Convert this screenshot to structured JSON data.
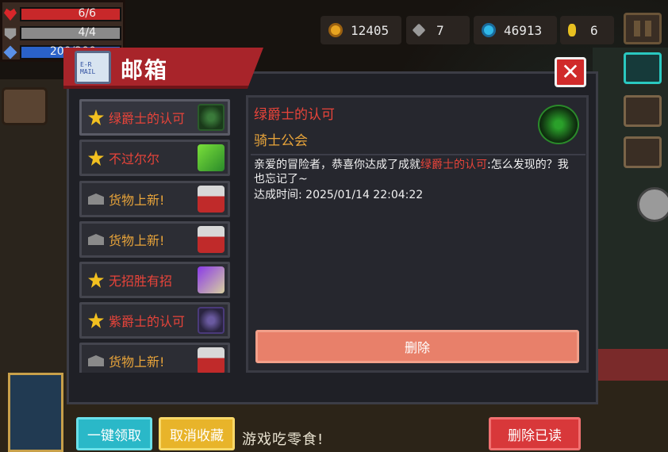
{
  "hud": {
    "hp": "6/6",
    "armor": "4/4",
    "energy": "200/200",
    "coins": "12405",
    "materials": "7",
    "gems": "46913",
    "seeds": "6"
  },
  "background_text": "游戏吃零食!",
  "mailbox": {
    "title": "邮箱",
    "icon_text": "E-R MAIL",
    "items": [
      {
        "label": "绿爵士的认可",
        "type": "star",
        "color": "red",
        "thumb": "green-knight-icon"
      },
      {
        "label": "不过尔尔",
        "type": "star",
        "color": "red",
        "thumb": "leaf-weapon-icon"
      },
      {
        "label": "货物上新!",
        "type": "envelope",
        "color": "gold",
        "thumb": "merchant-icon"
      },
      {
        "label": "货物上新!",
        "type": "envelope",
        "color": "gold",
        "thumb": "merchant-icon"
      },
      {
        "label": "无招胜有招",
        "type": "star",
        "color": "red",
        "thumb": "sword-icon"
      },
      {
        "label": "紫爵士的认可",
        "type": "star",
        "color": "red",
        "thumb": "purple-knight-icon"
      },
      {
        "label": "货物上新!",
        "type": "envelope",
        "color": "gold",
        "thumb": "merchant-icon"
      }
    ],
    "selected": {
      "title": "绿爵士的认可",
      "sender": "骑士公会",
      "body_prefix": "亲爱的冒险者，恭喜你达成了成就",
      "body_highlight": "绿爵士的认可",
      "body_suffix": ":怎么发现的？我也忘记了~",
      "time": "达成时间: 2025/01/14 22:04:22"
    },
    "delete_label": "删除",
    "buttons": {
      "claim_all": "一键领取",
      "unfavorite": "取消收藏",
      "delete_read": "删除已读"
    }
  }
}
